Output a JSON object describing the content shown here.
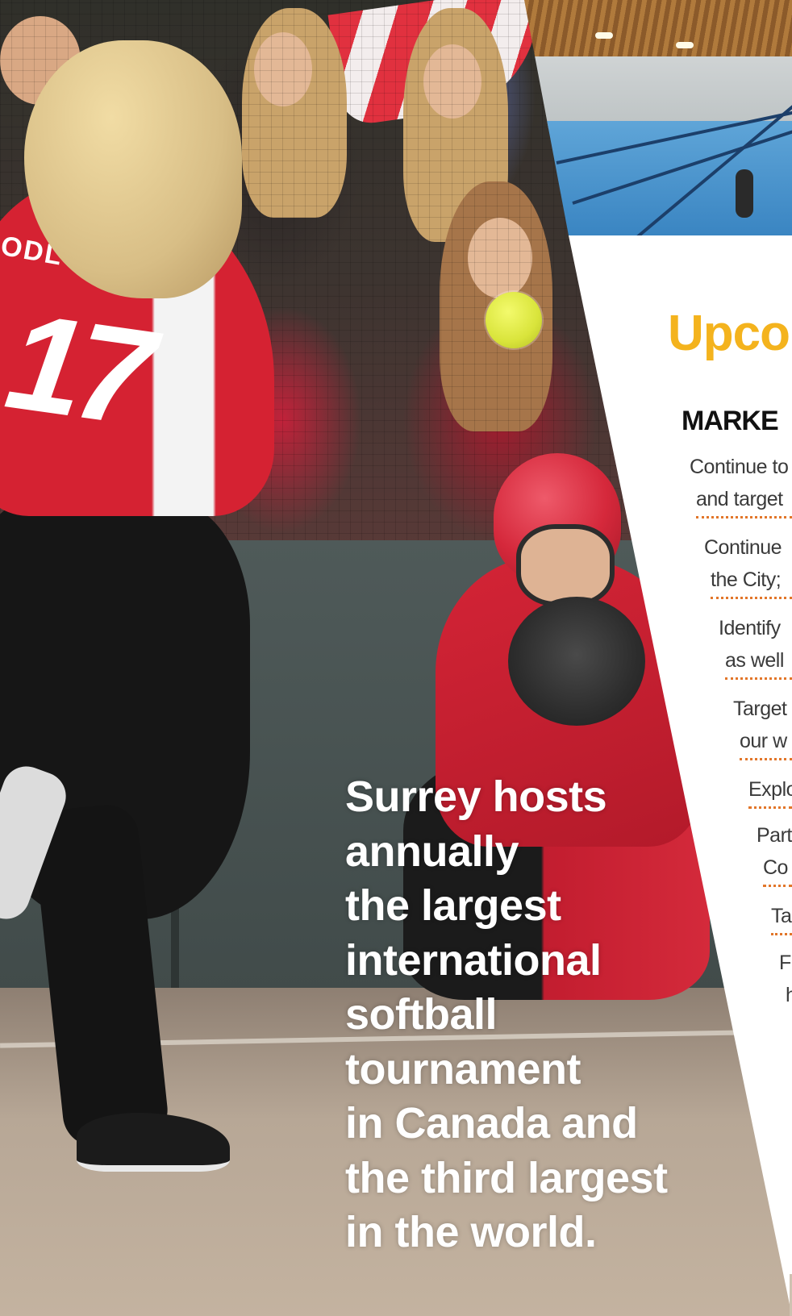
{
  "photo": {
    "jersey_number": "17",
    "jersey_name": "ODL  DEN"
  },
  "panel": {
    "title": "Upco",
    "subtitle": "MARKE",
    "bullets": [
      {
        "lines": [
          "Continue to",
          "and target"
        ]
      },
      {
        "lines": [
          "Continue",
          "the City;"
        ]
      },
      {
        "lines": [
          "Identify",
          "as well"
        ]
      },
      {
        "lines": [
          "Target",
          "our w"
        ]
      },
      {
        "lines": [
          "Explo"
        ]
      },
      {
        "lines": [
          "Part",
          "Co"
        ]
      },
      {
        "lines": [
          "Ta"
        ]
      },
      {
        "lines": [
          "F",
          "h"
        ]
      }
    ]
  },
  "callout": {
    "lines": [
      "Surrey hosts",
      "annually",
      "the largest",
      "international",
      "softball",
      "tournament",
      "in Canada and",
      "the third largest",
      "in the world."
    ]
  },
  "colors": {
    "accent_title": "#f4b31d",
    "dotted_rule": "#e2762a",
    "jersey_red": "#d52232"
  }
}
